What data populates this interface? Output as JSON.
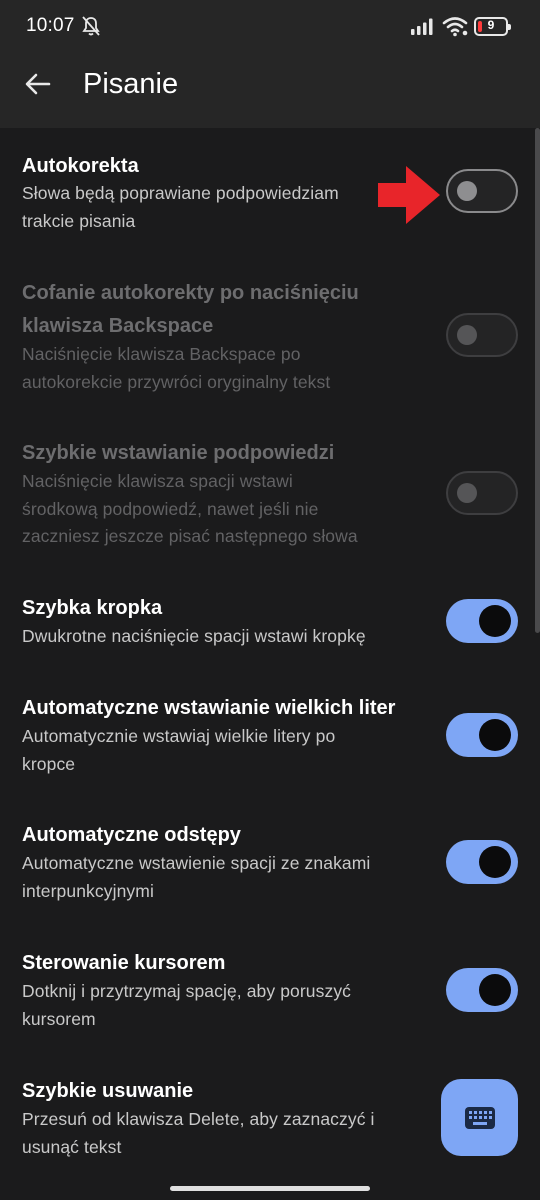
{
  "status_bar": {
    "time": "10:07",
    "battery": "9",
    "icons": [
      "mute-icon",
      "signal-icon",
      "wifi-icon",
      "battery-icon"
    ]
  },
  "header": {
    "title": "Pisanie",
    "back_icon": "arrow-left-icon"
  },
  "settings": [
    {
      "title": "Autokorekta",
      "desc_lines": [
        "Słowa będą poprawiane podpowiedziam",
        "trakcie pisania"
      ],
      "enabled": true,
      "on": false
    },
    {
      "title_lines": [
        "Cofanie autokorekty po naciśnięciu",
        "klawisza Backspace"
      ],
      "desc_lines": [
        "Naciśnięcie klawisza Backspace po",
        "autokorekcie przywróci oryginalny tekst"
      ],
      "enabled": false,
      "on": false
    },
    {
      "title": "Szybkie wstawianie podpowiedzi",
      "desc_lines": [
        "Naciśnięcie klawisza spacji wstawi",
        "środkową podpowiedź, nawet jeśli nie",
        "zaczniesz jeszcze pisać następnego słowa"
      ],
      "enabled": false,
      "on": false
    },
    {
      "title": "Szybka kropka",
      "desc_lines": [
        "Dwukrotne naciśnięcie spacji wstawi kropkę"
      ],
      "enabled": true,
      "on": true
    },
    {
      "title": "Automatyczne wstawianie wielkich liter",
      "desc_lines": [
        "Automatycznie wstawiaj wielkie litery po",
        "kropce"
      ],
      "enabled": true,
      "on": true
    },
    {
      "title": "Automatyczne odstępy",
      "desc_lines": [
        "Automatyczne wstawienie spacji ze znakami",
        "interpunkcyjnymi"
      ],
      "enabled": true,
      "on": true
    },
    {
      "title": "Sterowanie kursorem",
      "desc_lines": [
        "Dotknij i przytrzymaj spację, aby poruszyć",
        "kursorem"
      ],
      "enabled": true,
      "on": true
    },
    {
      "title": "Szybkie usuwanie",
      "desc_lines": [
        "Przesuń od klawisza Delete, aby zaznaczyć i",
        "usunąć tekst"
      ],
      "enabled": true
    }
  ],
  "fab": {
    "icon": "keyboard-icon"
  },
  "annotation": {
    "icon": "red-arrow-icon"
  },
  "colors": {
    "background": "#1b1b1c",
    "appbar": "#262626",
    "accent": "#7ea6f5",
    "annotation": "#e8252a"
  }
}
